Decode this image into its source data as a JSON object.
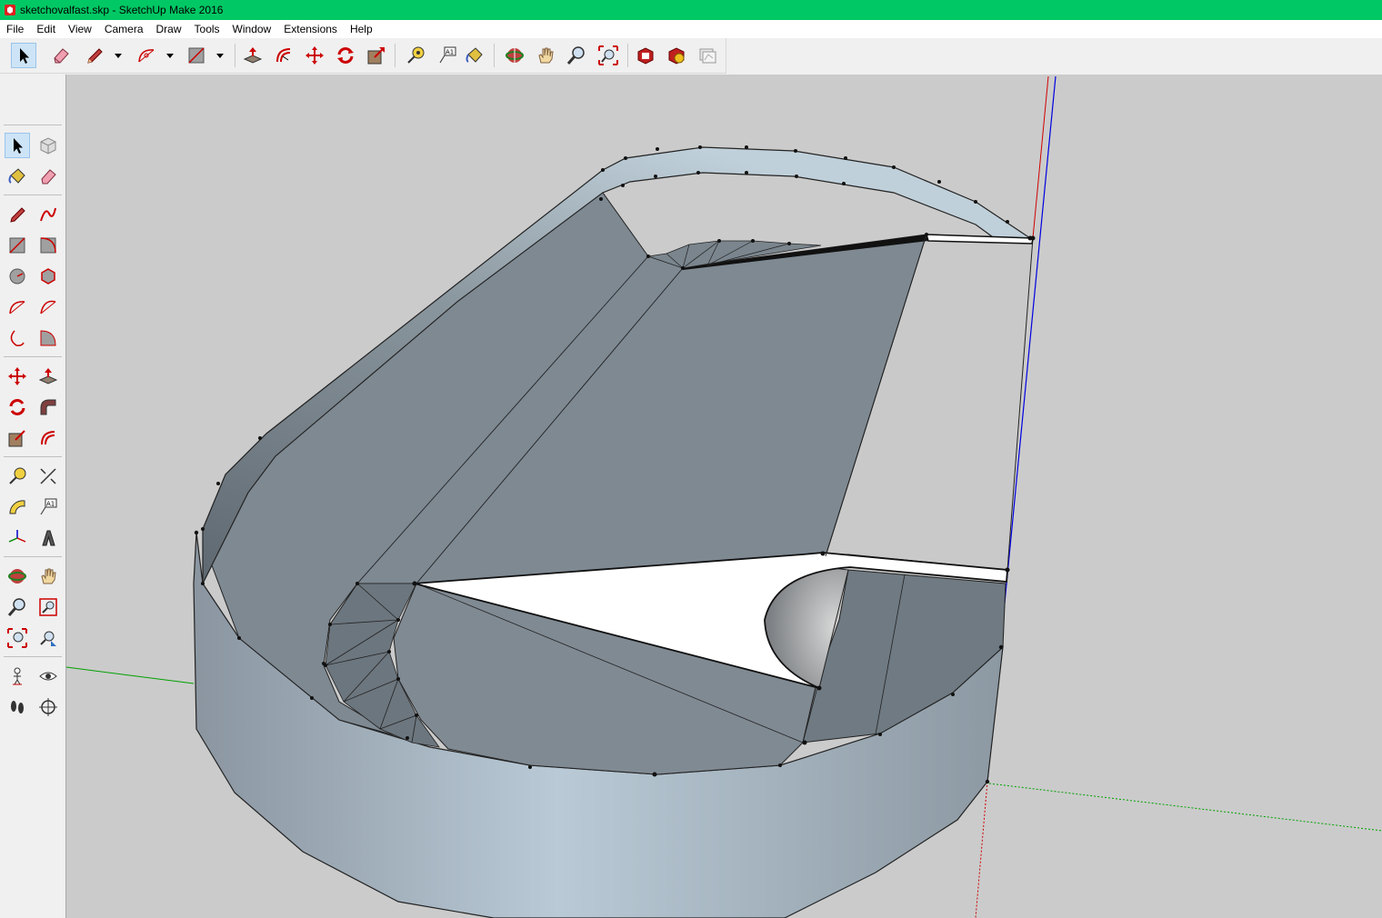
{
  "window": {
    "title": "sketchovalfast.skp - SketchUp Make 2016",
    "titlebar_color": "#00c864"
  },
  "menu": [
    "File",
    "Edit",
    "View",
    "Camera",
    "Draw",
    "Tools",
    "Window",
    "Extensions",
    "Help"
  ],
  "toolbar": {
    "tools": [
      "select-icon",
      "eraser-icon",
      "pencil-icon",
      "arc-icon",
      "rectangle-icon",
      "push-pull-icon",
      "offset-icon",
      "move-icon",
      "rotate-icon",
      "scale-icon",
      "tape-measure-icon",
      "text-icon",
      "paint-bucket-icon",
      "orbit-icon",
      "pan-icon",
      "zoom-icon",
      "zoom-extents-icon",
      "3d-warehouse-icon",
      "extension-warehouse-icon",
      "layout-icon"
    ],
    "selected": "select-icon"
  },
  "sidebar": {
    "tools": [
      "select-icon",
      "make-component-icon",
      "paint-bucket-icon",
      "eraser-icon",
      "line-icon",
      "freehand-icon",
      "rectangle-icon",
      "rotated-rectangle-icon",
      "circle-icon",
      "polygon-icon",
      "arc-icon",
      "two-point-arc-icon",
      "three-point-arc-icon",
      "pie-icon",
      "move-icon",
      "push-pull-icon",
      "rotate-icon",
      "follow-me-icon",
      "scale-icon",
      "offset-icon",
      "tape-measure-icon",
      "dimension-icon",
      "protractor-icon",
      "text-icon",
      "axes-icon",
      "3d-text-icon",
      "orbit-icon",
      "pan-icon",
      "zoom-icon",
      "zoom-window-icon",
      "zoom-extents-icon",
      "previous-view-icon",
      "position-camera-icon",
      "look-around-icon",
      "walk-icon",
      "section-plane-icon"
    ],
    "selected": "select-icon"
  },
  "viewport": {
    "background": "#cbcbcb",
    "axis_colors": {
      "red": "#d00000",
      "green": "#00a000",
      "blue": "#0000e0"
    }
  }
}
